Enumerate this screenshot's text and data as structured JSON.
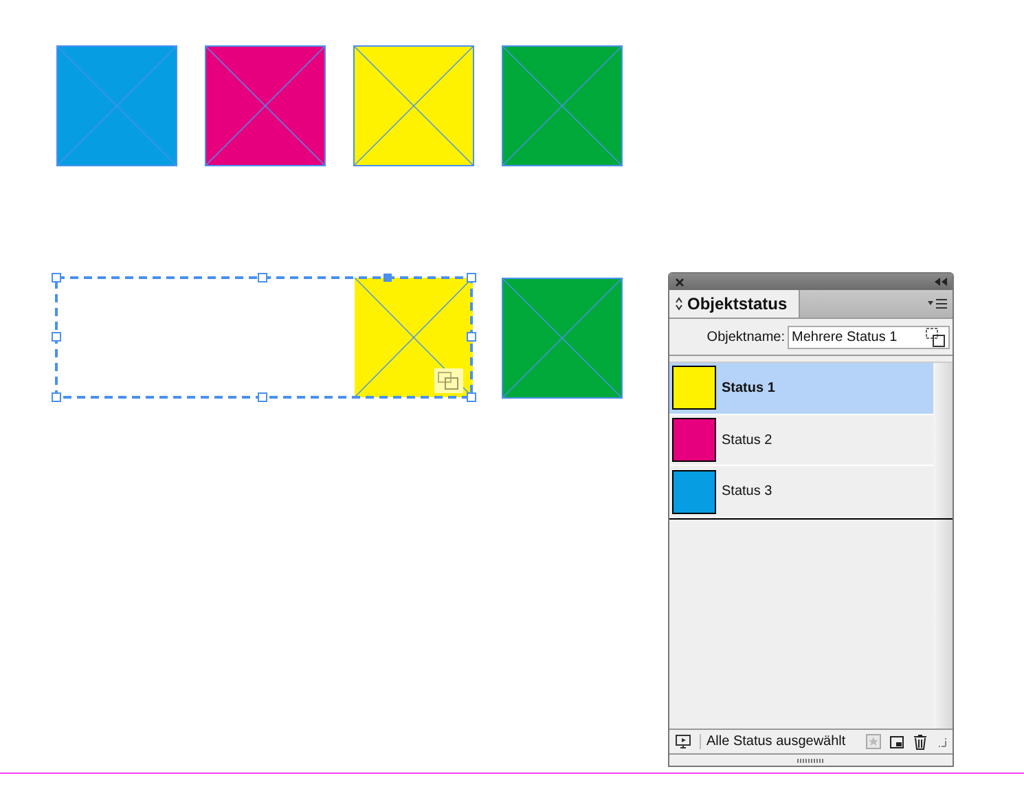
{
  "canvas": {
    "frames": [
      {
        "color": "#079de3"
      },
      {
        "color": "#e6007e"
      },
      {
        "color": "#fff200"
      },
      {
        "color": "#00a93a"
      }
    ],
    "multistate": {
      "color": "#fff200"
    },
    "extra_frame": {
      "color": "#00a93a"
    }
  },
  "panel": {
    "title": "Objektstatus",
    "field_label": "Objektname:",
    "field_value": "Mehrere Status 1",
    "states": [
      {
        "name": "Status 1",
        "color": "#fff200",
        "selected": true
      },
      {
        "name": "Status 2",
        "color": "#e6007e",
        "selected": false
      },
      {
        "name": "Status 3",
        "color": "#079de3",
        "selected": false
      }
    ],
    "footer_text": "Alle Status ausgewählt"
  }
}
